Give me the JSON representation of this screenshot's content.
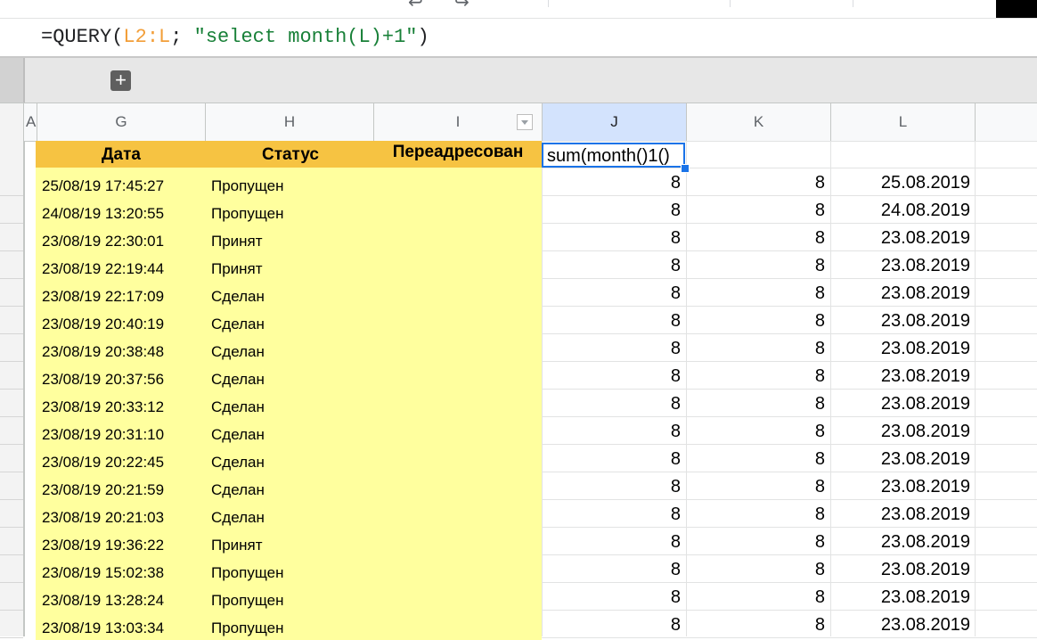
{
  "formula_bar": {
    "text_prefix": "=QUERY(",
    "range_ref": "L2:L",
    "separator": "; ",
    "query_string": "\"select month(L)+1\"",
    "closing": ")"
  },
  "group_bar": {
    "add_group_glyph": "+"
  },
  "columns": [
    "A",
    "G",
    "H",
    "I",
    "J",
    "K",
    "L"
  ],
  "table_headers": {
    "date": "Дата",
    "status": "Статус",
    "forwarded": "Переадресован"
  },
  "active_cell": {
    "column": "J",
    "value": "sum(month()1()"
  },
  "rows": [
    {
      "date": "25/08/19 17:45:27",
      "status": "Пропущен",
      "j": "8",
      "k": "8",
      "l": "25.08.2019"
    },
    {
      "date": "24/08/19 13:20:55",
      "status": "Пропущен",
      "j": "8",
      "k": "8",
      "l": "24.08.2019"
    },
    {
      "date": "23/08/19 22:30:01",
      "status": "Принят",
      "j": "8",
      "k": "8",
      "l": "23.08.2019"
    },
    {
      "date": "23/08/19 22:19:44",
      "status": "Принят",
      "j": "8",
      "k": "8",
      "l": "23.08.2019"
    },
    {
      "date": "23/08/19 22:17:09",
      "status": "Сделан",
      "j": "8",
      "k": "8",
      "l": "23.08.2019"
    },
    {
      "date": "23/08/19 20:40:19",
      "status": "Сделан",
      "j": "8",
      "k": "8",
      "l": "23.08.2019"
    },
    {
      "date": "23/08/19 20:38:48",
      "status": "Сделан",
      "j": "8",
      "k": "8",
      "l": "23.08.2019"
    },
    {
      "date": "23/08/19 20:37:56",
      "status": "Сделан",
      "j": "8",
      "k": "8",
      "l": "23.08.2019"
    },
    {
      "date": "23/08/19 20:33:12",
      "status": "Сделан",
      "j": "8",
      "k": "8",
      "l": "23.08.2019"
    },
    {
      "date": "23/08/19 20:31:10",
      "status": "Сделан",
      "j": "8",
      "k": "8",
      "l": "23.08.2019"
    },
    {
      "date": "23/08/19 20:22:45",
      "status": "Сделан",
      "j": "8",
      "k": "8",
      "l": "23.08.2019"
    },
    {
      "date": "23/08/19 20:21:59",
      "status": "Сделан",
      "j": "8",
      "k": "8",
      "l": "23.08.2019"
    },
    {
      "date": "23/08/19 20:21:03",
      "status": "Сделан",
      "j": "8",
      "k": "8",
      "l": "23.08.2019"
    },
    {
      "date": "23/08/19 19:36:22",
      "status": "Принят",
      "j": "8",
      "k": "8",
      "l": "23.08.2019"
    },
    {
      "date": "23/08/19 15:02:38",
      "status": "Пропущен",
      "j": "8",
      "k": "8",
      "l": "23.08.2019"
    },
    {
      "date": "23/08/19 13:28:24",
      "status": "Пропущен",
      "j": "8",
      "k": "8",
      "l": "23.08.2019"
    },
    {
      "date": "23/08/19 13:03:34",
      "status": "Пропущен",
      "j": "8",
      "k": "8",
      "l": "23.08.2019"
    }
  ],
  "colors": {
    "header_fill": "#f6c342",
    "data_fill": "#ffff9e",
    "selection": "#1a73e8",
    "range_ref": "#f29e38",
    "string": "#188038"
  }
}
